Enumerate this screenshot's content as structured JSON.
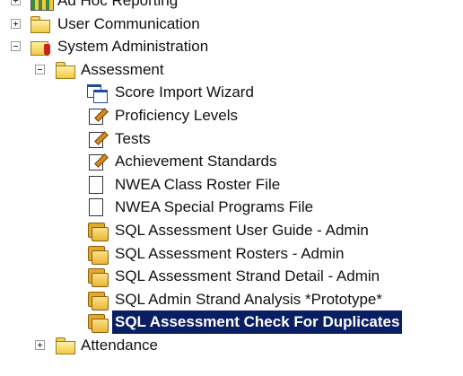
{
  "tree": {
    "nodes": [
      {
        "label": "Ad Hoc Reporting",
        "icon": "report-folder-icon",
        "expander": "plus"
      },
      {
        "label": "User Communication",
        "icon": "folder-icon",
        "expander": "plus"
      },
      {
        "label": "System Administration",
        "icon": "admin-folder-icon",
        "expander": "minus"
      },
      {
        "label": "Assessment",
        "icon": "folder-open-icon",
        "expander": "minus"
      },
      {
        "label": "Score Import Wizard",
        "icon": "wizard-icon"
      },
      {
        "label": "Proficiency Levels",
        "icon": "edit-document-icon"
      },
      {
        "label": "Tests",
        "icon": "edit-document-icon"
      },
      {
        "label": "Achievement Standards",
        "icon": "edit-document-icon"
      },
      {
        "label": "NWEA Class Roster File",
        "icon": "document-icon"
      },
      {
        "label": "NWEA Special Programs File",
        "icon": "document-icon"
      },
      {
        "label": "SQL Assessment User Guide - Admin",
        "icon": "report-stack-icon"
      },
      {
        "label": "SQL Assessment Rosters - Admin",
        "icon": "report-stack-icon"
      },
      {
        "label": "SQL Assessment Strand Detail - Admin",
        "icon": "report-stack-icon"
      },
      {
        "label": "SQL Admin Strand Analysis *Prototype*",
        "icon": "report-stack-icon"
      },
      {
        "label": "SQL Assessment Check For Duplicates",
        "icon": "report-stack-icon",
        "selected": true
      },
      {
        "label": "Attendance",
        "icon": "folder-icon",
        "expander": "plus"
      }
    ]
  },
  "colors": {
    "selection_background": "#0a1f63",
    "selection_text": "#ffffff",
    "folder": "#f2c943"
  }
}
